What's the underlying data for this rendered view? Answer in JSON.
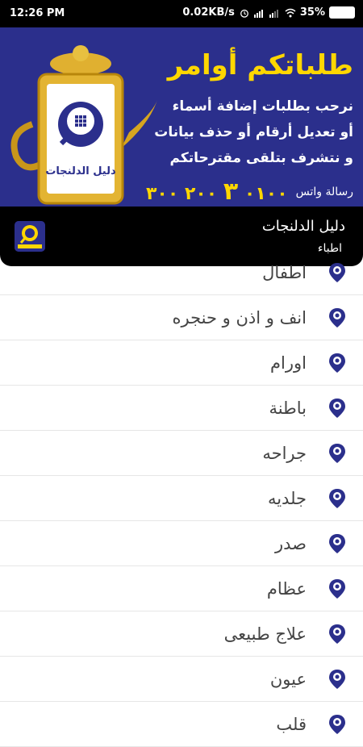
{
  "status_bar": {
    "time": "12:26 PM",
    "speed": "0.02KB/s",
    "battery": "35%"
  },
  "banner": {
    "headline": "طلباتكم أوامر",
    "line1": "نرحب بطلبات إضافة أسماء",
    "line2": "أو تعديل أرقام أو حذف بيانات",
    "line3": "و نتشرف بتلقى مقترحاتكم",
    "whatsapp_label": "رسالة واتس",
    "phone_prefix": "٠١٠٠",
    "phone_mid": "٣",
    "phone_rest": "٢٠٠ ٣٠٠",
    "logo_text": "دليل الدلنجات"
  },
  "header": {
    "title": "دليل الدلنجات",
    "subtitle": "اطباء"
  },
  "list": {
    "items": [
      {
        "label": "اطفال"
      },
      {
        "label": "انف و اذن و حنجره"
      },
      {
        "label": "اورام"
      },
      {
        "label": "باطنة"
      },
      {
        "label": "جراحه"
      },
      {
        "label": "جلديه"
      },
      {
        "label": "صدر"
      },
      {
        "label": "عظام"
      },
      {
        "label": "علاج طبيعى"
      },
      {
        "label": "عيون"
      },
      {
        "label": "قلب"
      }
    ]
  },
  "colors": {
    "banner_bg": "#2b2f8c",
    "accent_gold": "#ffd700",
    "pin_blue": "#2b2f8c"
  }
}
